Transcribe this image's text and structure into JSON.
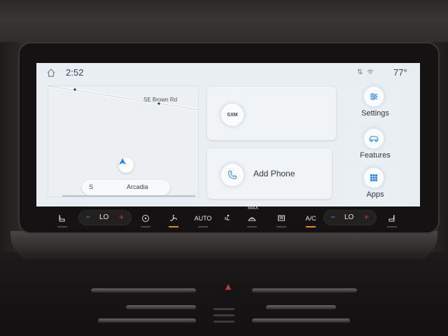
{
  "status": {
    "time": "2:52",
    "temperature": "77°"
  },
  "map": {
    "street": "SE Brown Rd",
    "search_direction": "S",
    "search_place": "Arcadia"
  },
  "cards": {
    "sxm_label": "SXM",
    "add_phone": "Add Phone"
  },
  "apps": [
    {
      "label": "Settings",
      "icon": "settings-sliders-icon"
    },
    {
      "label": "Features",
      "icon": "car-icon"
    },
    {
      "label": "Apps",
      "icon": "apps-grid-icon"
    }
  ],
  "climate": {
    "driver_temp": "LO",
    "passenger_temp": "LO",
    "auto": "AUTO",
    "max_label": "MAX",
    "ac": "A/C",
    "accent_on": "#e08a2c",
    "cold": "#4d8ce6",
    "hot": "#d63b3b"
  }
}
